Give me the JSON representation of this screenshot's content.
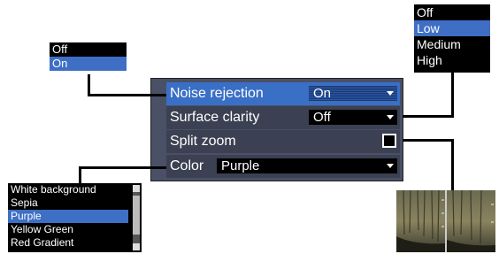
{
  "noise_popup": {
    "options": [
      "Off",
      "On"
    ],
    "selected": "On"
  },
  "level_popup": {
    "options": [
      "Off",
      "Low",
      "Medium",
      "High"
    ],
    "selected": "Low"
  },
  "panel": {
    "rows": [
      {
        "label": "Noise rejection",
        "value": "On"
      },
      {
        "label": "Surface clarity",
        "value": "Off"
      },
      {
        "label": "Split zoom"
      },
      {
        "label": "Color",
        "value": "Purple"
      }
    ]
  },
  "color_list": {
    "options": [
      "White background",
      "Sepia",
      "Purple",
      "Yellow Green",
      "Red Gradient"
    ],
    "selected": "Purple"
  },
  "split_zoom_checked": true
}
